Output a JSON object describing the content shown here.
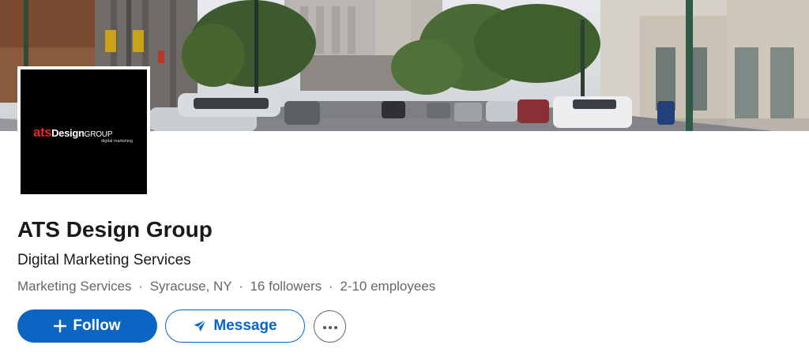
{
  "logo": {
    "brand_ats": "ats",
    "brand_design": "Design",
    "brand_group": "GROUP",
    "brand_tagline": "digital marketing"
  },
  "company": {
    "name": "ATS Design Group",
    "tagline": "Digital Marketing Services",
    "industry": "Marketing Services",
    "location": "Syracuse, NY",
    "followers": "16 followers",
    "employees": "2-10 employees",
    "separator": "·"
  },
  "actions": {
    "follow_label": "Follow",
    "message_label": "Message",
    "more_label": "More"
  },
  "icons": {
    "follow": "plus-icon",
    "message": "send-icon",
    "more": "ellipsis-icon"
  },
  "colors": {
    "primary": "#0a66c2",
    "text": "#191919",
    "muted": "#666666",
    "logo_accent": "#e8251f"
  }
}
